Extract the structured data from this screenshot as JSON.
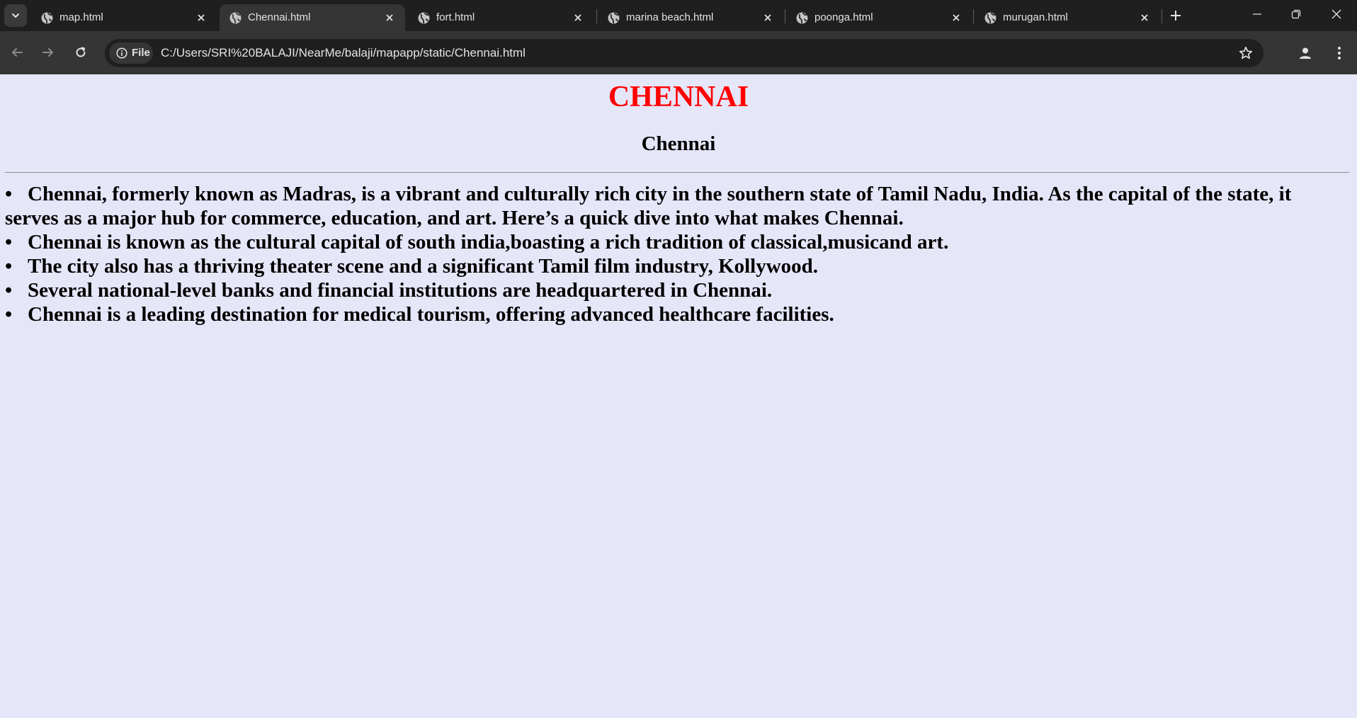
{
  "browser": {
    "tabs": [
      {
        "title": "map.html",
        "active": false
      },
      {
        "title": "Chennai.html",
        "active": true
      },
      {
        "title": "fort.html",
        "active": false
      },
      {
        "title": "marina beach.html",
        "active": false
      },
      {
        "title": "poonga.html",
        "active": false
      },
      {
        "title": "murugan.html",
        "active": false
      }
    ],
    "site_chip": "File",
    "url": "C:/Users/SRI%20BALAJI/NearMe/balaji/mapapp/static/Chennai.html",
    "colors": {
      "tabstrip_bg": "#1f1f1f",
      "toolbar_bg": "#353535",
      "text": "#e3e3e3"
    }
  },
  "page": {
    "heading": "CHENNAI",
    "subheading": "Chennai",
    "bullet_glyph": "•",
    "items": [
      "Chennai, formerly known as Madras, is a vibrant and culturally rich city in the southern state of Tamil Nadu, India. As the capital of the state, it serves as a major hub for commerce, education, and art. Here’s a quick dive into what makes Chennai.",
      "Chennai is known as the cultural capital of south india,boasting a rich tradition of classical,musicand art.",
      "The city also has a thriving theater scene and a significant Tamil film industry, Kollywood.",
      "Several national-level banks and financial institutions are headquartered in Chennai.",
      "Chennai is a leading destination for medical tourism, offering advanced healthcare facilities."
    ],
    "colors": {
      "background": "#e6e6f9",
      "heading": "#ff0000",
      "text": "#000000"
    }
  }
}
